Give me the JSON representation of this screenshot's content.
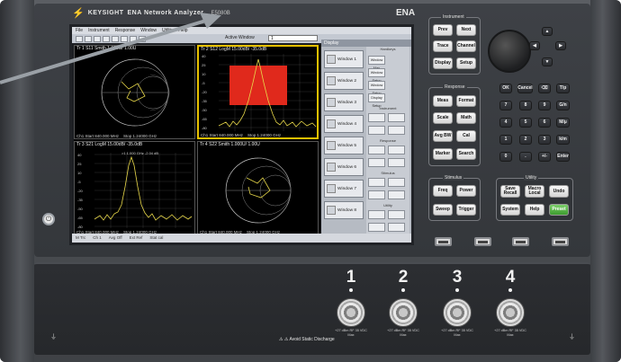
{
  "brand": {
    "logo": "KEYSIGHT",
    "window_title": "ENA Network Analyzer",
    "model": "E5080B",
    "ena": "ENA"
  },
  "screen": {
    "menu": [
      "File",
      "Instrument",
      "Response",
      "Window",
      "Utility",
      "Help"
    ],
    "active_window_label": "Active Window",
    "active_window_value": "1",
    "traces": [
      {
        "title": "Tr 1  S11 Smith 1.000U/  1.00U",
        "foot_start": "Ch1  Start  840.000 MHz",
        "foot_stop": "Stop  1.24000 GHz",
        "type": "smith",
        "active": false
      },
      {
        "title": "Tr 2  S12 LogM 15.00dB/  -35.0dB",
        "foot_start": "Ch1  Start  840.000 MHz",
        "foot_stop": "Stop  1.24000 GHz",
        "type": "logmag-box",
        "active": true
      },
      {
        "title": "Tr 3  S21 LogM 15.00dB/  -35.0dB",
        "foot_start": "Ch1  Start  840.000 MHz",
        "foot_stop": "Stop  1.24000 GHz",
        "type": "logmag-peak",
        "active": false,
        "marker": ">1   1.000 GHz   -2.04 dB"
      },
      {
        "title": "Tr 4  S22 Smith 1.000U/  1.00U",
        "foot_start": "Ch1  Start  840.000 MHz",
        "foot_stop": "Stop  1.24000 GHz",
        "type": "smith",
        "active": false
      }
    ],
    "yticks_tr2": [
      "40",
      "25",
      "10",
      "-5",
      "-20",
      "-35",
      "-50",
      "-65",
      "-80",
      "-95",
      "-110"
    ],
    "yticks_tr3": [
      "40",
      "25",
      "10",
      "-5",
      "-20",
      "-35",
      "-50",
      "-65",
      "-80",
      "-95",
      "-110"
    ],
    "display_header": "Display",
    "window_buttons": [
      "Window 1",
      "Window 2",
      "Window 3",
      "Window 4",
      "Window 5",
      "Window 6",
      "Window 7",
      "Window 8"
    ],
    "window_options": [
      "Window Max",
      "Window Setup",
      "Window Setup",
      "Display Setup"
    ],
    "softkey_header": "Hardkeys",
    "softkey_sections": [
      "Instrument",
      "Response",
      "Stimulus",
      "Utility"
    ],
    "status": [
      "M Trc",
      "Ch 1",
      "Avg Off",
      "Ext Ref",
      "Stat cal"
    ]
  },
  "keys": {
    "instrument_label": "Instrument",
    "prev": "Prev",
    "next": "Next",
    "trace": "Trace",
    "channel": "Channel",
    "display": "Display",
    "setup": "Setup",
    "response_label": "Response",
    "meas": "Meas",
    "format": "Format",
    "scale": "Scale",
    "math": "Math",
    "avg_bw": "Avg BW",
    "cal": "Cal",
    "marker": "Marker",
    "search": "Search",
    "stimulus_label": "Stimulus",
    "freq": "Freq",
    "power": "Power",
    "sweep": "Sweep",
    "trigger": "Trigger",
    "utility_label": "Utility",
    "save_recall": "Save Recall",
    "macro_local": "Macro Local",
    "undo": "Undo",
    "system": "System",
    "help": "Help",
    "preset": "Preset",
    "ok": "OK",
    "cancel": "Cancel",
    "bksp": "⌫",
    "tp": "T/p",
    "numpad": [
      [
        "7",
        "8",
        "9",
        "G/n"
      ],
      [
        "4",
        "5",
        "6",
        "M/μ"
      ],
      [
        "1",
        "2",
        "3",
        "k/m"
      ],
      [
        "0",
        ".",
        "+/-",
        "Enter"
      ]
    ]
  },
  "ports": [
    {
      "num": "1",
      "label": "+27 dBm RF 35 VDC Max"
    },
    {
      "num": "2",
      "label": "+27 dBm RF 35 VDC Max"
    },
    {
      "num": "3",
      "label": "+27 dBm RF 35 VDC Max"
    },
    {
      "num": "4",
      "label": "+27 dBm RF 35 VDC Max"
    }
  ],
  "warning": "⚠ ⚠ Avoid Static Discharge",
  "colors": {
    "trace_yellow": "#e8d84a",
    "smith_grid": "#c8c8c8",
    "active_border": "#e6c000",
    "fill_red": "#e0291c",
    "preset_green": "#48a83a"
  }
}
